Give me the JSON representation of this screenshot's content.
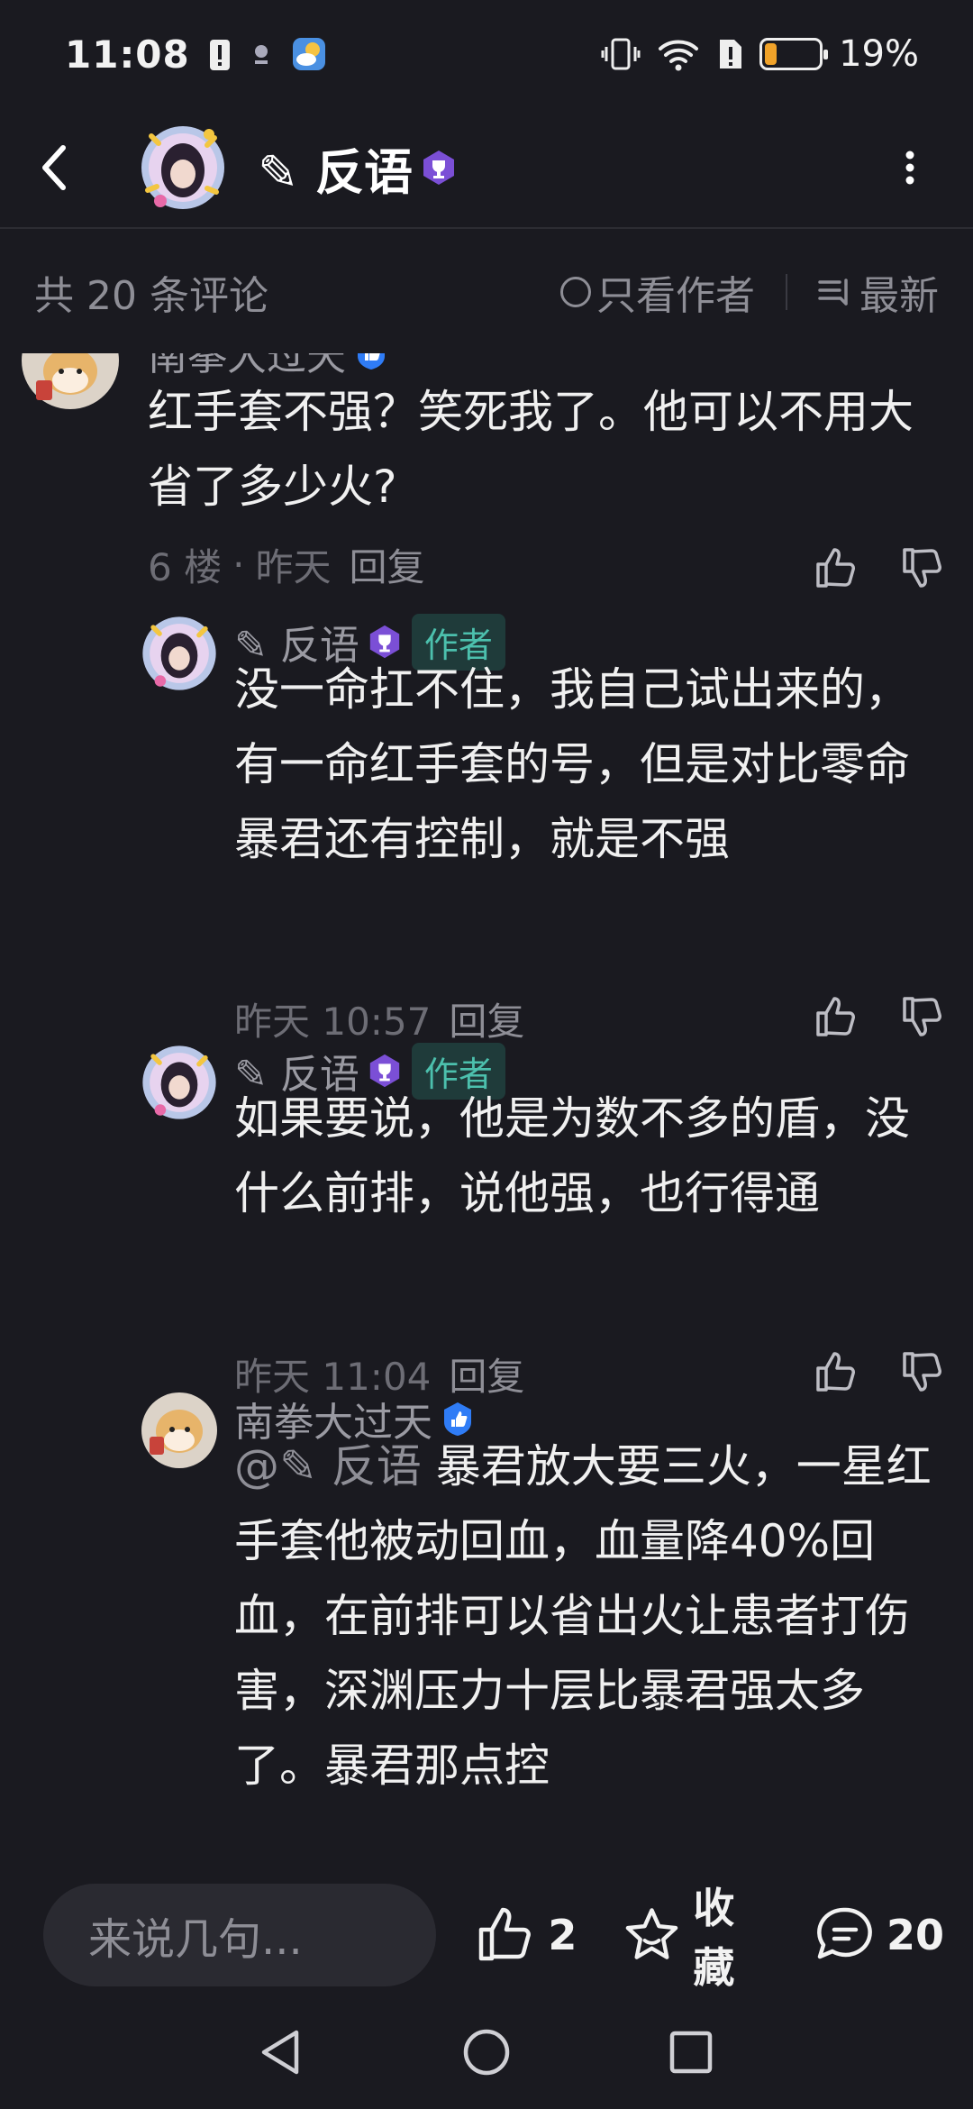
{
  "status": {
    "time": "11:08",
    "battery_percent": "19%",
    "battery_level": 0.19
  },
  "header": {
    "title": "✎ 反语"
  },
  "comments_bar": {
    "count_label": "共 20 条评论",
    "only_author_label": "只看作者",
    "sort_label": "最新"
  },
  "comments": [
    {
      "user": "南拳大过天",
      "text": "红手套不强？笑死我了。他可以不用大省了多少火?",
      "floor": "6 楼",
      "time": "昨天",
      "reply_label": "回复"
    }
  ],
  "replies": [
    {
      "user": "✎ 反语",
      "tag": "作者",
      "text": "没一命扛不住，我自己试出来的，有一命红手套的号，但是对比零命暴君还有控制，就是不强",
      "time": "昨天 10:57",
      "reply_label": "回复"
    },
    {
      "user": "✎ 反语",
      "tag": "作者",
      "text": "如果要说，他是为数不多的盾，没什么前排，说他强，也行得通",
      "time": "昨天 11:04",
      "reply_label": "回复"
    },
    {
      "user": "南拳大过天",
      "mention": "@✎ 反语",
      "text": "暴君放大要三火，一星红手套他被动回血，血量降40%回血，在前排可以省出火让患者打伤害，深渊压力十层比暴君强太多了。暴君那点控"
    }
  ],
  "bottom": {
    "input_placeholder": "来说几句...",
    "like_count": "2",
    "collect_label": "收藏",
    "comment_count": "20"
  },
  "colors": {
    "background": "#1a1a20",
    "author_tag_bg": "#1f3b3a",
    "author_tag_text": "#4cc0ad",
    "trophy_purple": "#7b4fd6",
    "verify_blue": "#2f7cf6",
    "battery_orange": "#f0a229"
  }
}
